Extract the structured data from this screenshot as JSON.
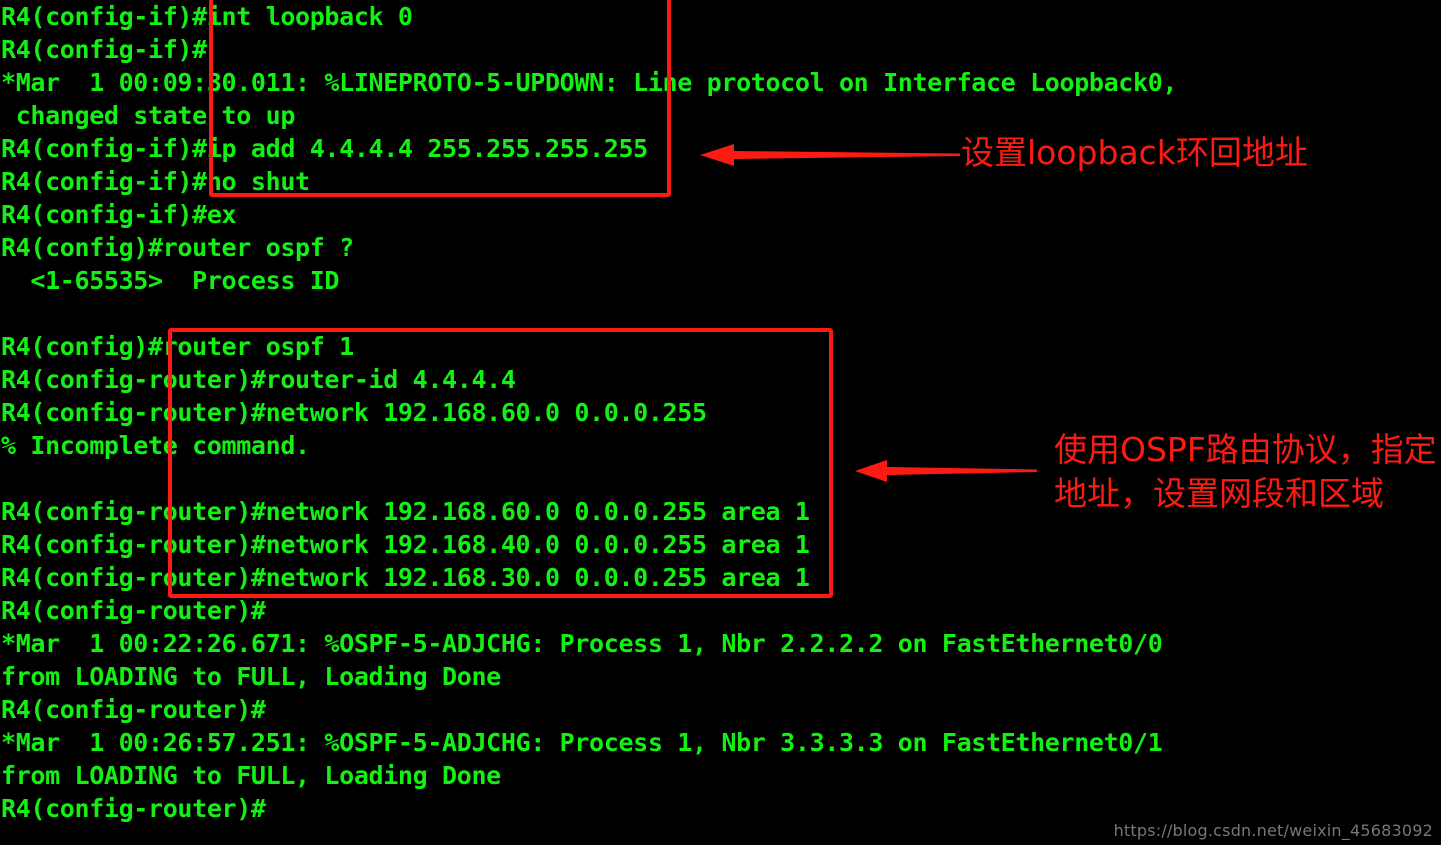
{
  "theme": {
    "background": "#000000",
    "terminal_text": "#14f014",
    "annotation": "#fc1b12",
    "watermark_text": "#8c8c8c"
  },
  "terminal": {
    "lines": [
      "R4(config-if)#int loopback 0",
      "R4(config-if)#",
      "*Mar  1 00:09:30.011: %LINEPROTO-5-UPDOWN: Line protocol on Interface Loopback0,",
      " changed state to up",
      "R4(config-if)#ip add 4.4.4.4 255.255.255.255",
      "R4(config-if)#no shut",
      "R4(config-if)#ex",
      "R4(config)#router ospf ?",
      "  <1-65535>  Process ID",
      "",
      "R4(config)#router ospf 1",
      "R4(config-router)#router-id 4.4.4.4",
      "R4(config-router)#network 192.168.60.0 0.0.0.255",
      "% Incomplete command.",
      "",
      "R4(config-router)#network 192.168.60.0 0.0.0.255 area 1",
      "R4(config-router)#network 192.168.40.0 0.0.0.255 area 1",
      "R4(config-router)#network 192.168.30.0 0.0.0.255 area 1",
      "R4(config-router)#",
      "*Mar  1 00:22:26.671: %OSPF-5-ADJCHG: Process 1, Nbr 2.2.2.2 on FastEthernet0/0",
      "from LOADING to FULL, Loading Done",
      "R4(config-router)#",
      "*Mar  1 00:26:57.251: %OSPF-5-ADJCHG: Process 1, Nbr 3.3.3.3 on FastEthernet0/1",
      "from LOADING to FULL, Loading Done",
      "R4(config-router)#"
    ]
  },
  "annotations": {
    "loopback": {
      "text": "设置loopback环回地址",
      "arrow_name": "left-arrow-icon"
    },
    "ospf": {
      "line1": "使用OSPF路由协议，指定",
      "line2": "地址，设置网段和区域",
      "arrow_name": "left-arrow-icon"
    }
  },
  "highlight_boxes": {
    "loopback_box_label": "loopback-config-highlight",
    "ospf_box_label": "ospf-config-highlight"
  },
  "watermark": {
    "url": "https://blog.csdn.net/weixin_45683092"
  }
}
